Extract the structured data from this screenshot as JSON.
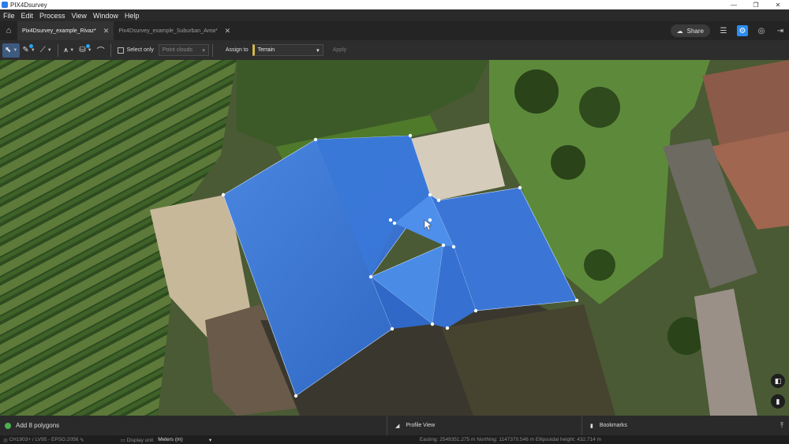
{
  "window": {
    "title": "PIX4Dsurvey",
    "minimize": "—",
    "maximize": "❐",
    "close": "✕"
  },
  "menu": [
    "File",
    "Edit",
    "Process",
    "View",
    "Window",
    "Help"
  ],
  "tabs": [
    {
      "label": "Pix4Dsurvey_example_Rivaz*",
      "active": true
    },
    {
      "label": "Pix4Dsurvey_example_Suburban_Area*",
      "active": false
    }
  ],
  "header": {
    "share_label": "Share"
  },
  "toolbar": {
    "select_only_label": "Select only",
    "point_clouds_placeholder": "Point clouds",
    "assign_to_label": "Assign to",
    "assign_value": "Terrain",
    "apply_label": "Apply"
  },
  "bottom_panel": {
    "status_message": "Add 8 polygons",
    "profile_view_label": "Profile View",
    "bookmarks_label": "Bookmarks"
  },
  "statusbar": {
    "crs": "CH1903+ / LV95 - EPSG:2056",
    "display_unit_label": "Display unit",
    "display_unit_value": "Meters (m)",
    "coordinates": "Easting: 2549351.275 m  Northing: 1147370.546 m  Ellipsoidal height: 432.714 m"
  },
  "colors": {
    "polygon_fill": "#3a78d8",
    "active_accent": "#2b8cf0",
    "status_dot": "#4caf50"
  },
  "icons": [
    "home-icon",
    "cloud-icon",
    "sliders-icon",
    "gear-icon",
    "globe-icon",
    "sign-out-icon",
    "map-icon",
    "bookmark-icon",
    "chart-icon"
  ]
}
